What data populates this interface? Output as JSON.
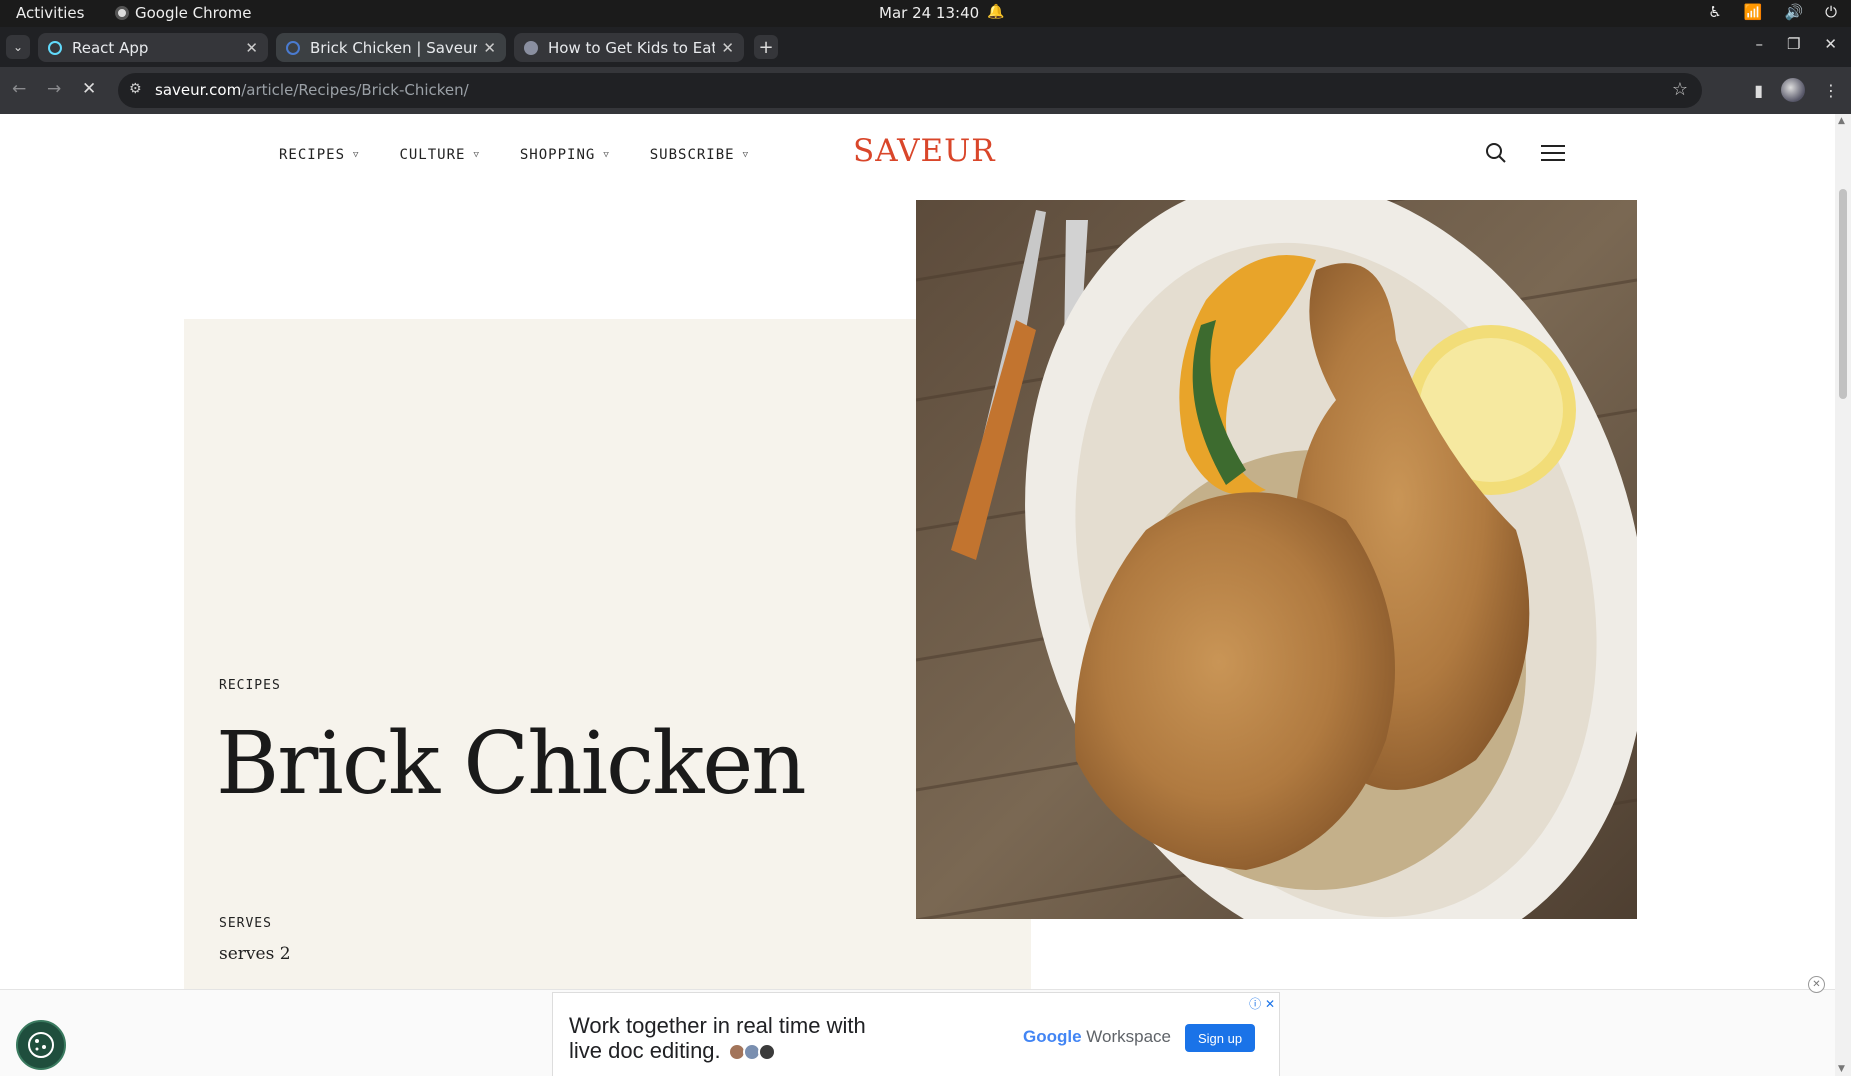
{
  "system_bar": {
    "activities": "Activities",
    "app_name": "Google Chrome",
    "clock": "Mar 24  13:40"
  },
  "browser": {
    "tabs": [
      {
        "title": "React App",
        "favicon_color": "#61dafb",
        "active": false
      },
      {
        "title": "Brick Chicken | Saveur",
        "favicon_color": "#4a7bd0",
        "active": true
      },
      {
        "title": "How to Get Kids to Eat S",
        "favicon_color": "#8a8fa0",
        "active": false
      }
    ],
    "url_host": "saveur.com",
    "url_path": "/article/Recipes/Brick-Chicken/"
  },
  "site": {
    "nav": [
      {
        "label": "RECIPES"
      },
      {
        "label": "CULTURE"
      },
      {
        "label": "SHOPPING"
      },
      {
        "label": "SUBSCRIBE"
      }
    ],
    "logo": "SAVEUR",
    "brand_color": "#d9462a"
  },
  "article": {
    "category": "RECIPES",
    "title": "Brick Chicken",
    "serves_label": "SERVES",
    "serves_value": "serves 2"
  },
  "ad": {
    "headline_line1": "Work together in real time with",
    "headline_line2": "live doc editing.",
    "brand_google": "Google",
    "brand_product": "Workspace",
    "cta": "Sign up"
  }
}
